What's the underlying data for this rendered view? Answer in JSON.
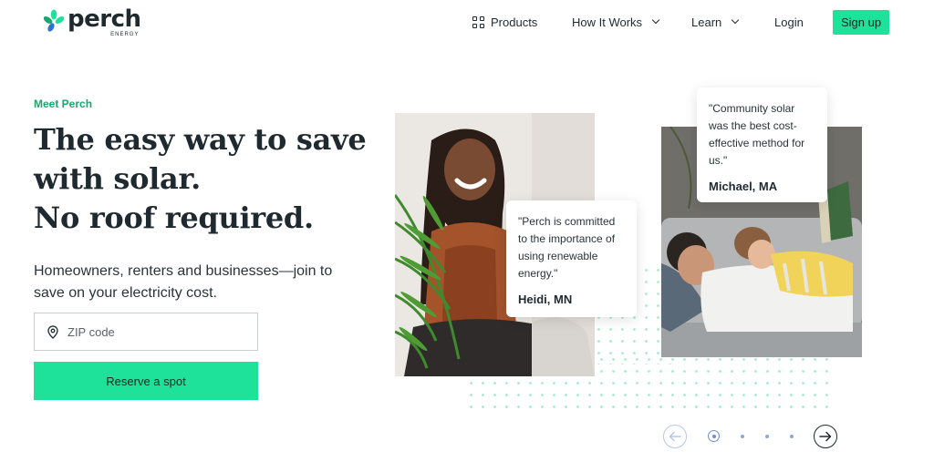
{
  "brand": {
    "name": "perch",
    "sub": "ENERGY"
  },
  "nav": {
    "products": "Products",
    "how_it_works": "How It Works",
    "learn": "Learn",
    "login": "Login",
    "signup": "Sign up"
  },
  "hero": {
    "eyebrow": "Meet Perch",
    "headline_1": "The easy way to save",
    "headline_2": "with solar.",
    "headline_3": "No roof required.",
    "subtext": "Homeowners, renters and businesses—join to save on your electricity cost.",
    "zip_placeholder": "ZIP code",
    "cta": "Reserve a spot"
  },
  "testimonials": [
    {
      "quote": "\"Perch is committed to the importance of using renewable energy.\"",
      "name": "Heidi, MN"
    },
    {
      "quote": "\"Community solar was the best cost-effective method for us.\"",
      "name": "Michael, MA"
    }
  ],
  "carousel": {
    "total": 5,
    "active_index": 0
  },
  "colors": {
    "accent": "#1ee29a",
    "eyebrow": "#1aa56f",
    "highlight": "#bff6dd",
    "text": "#1f2a30"
  },
  "icons": [
    "leaf-logo-icon",
    "grid-icon",
    "chevron-down-icon",
    "location-pin-icon",
    "arrow-left-icon",
    "arrow-right-icon"
  ]
}
